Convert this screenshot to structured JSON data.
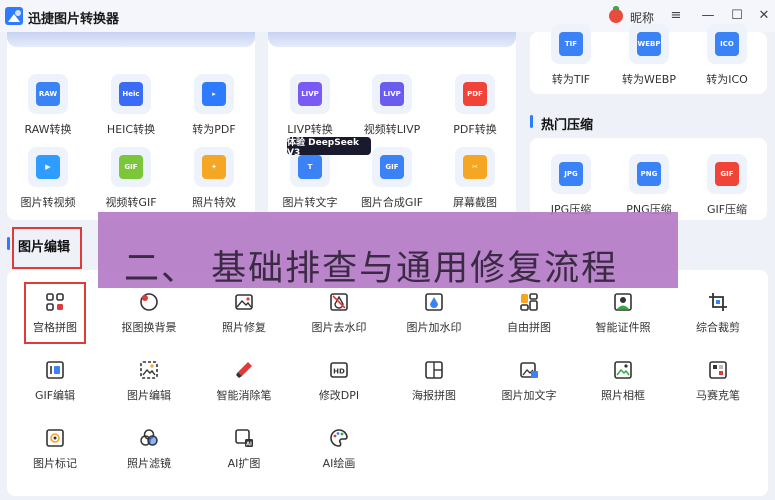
{
  "app": {
    "title": "迅捷图片转换器",
    "nickname": "昵称"
  },
  "window_controls": {
    "menu": "≡",
    "minimize": "—",
    "maximize": "☐",
    "close": "✕"
  },
  "convert_tools_left": [
    {
      "label": "RAW转换",
      "badge": "RAW",
      "color": "#3b82f6"
    },
    {
      "label": "HEIC转换",
      "badge": "Heic",
      "color": "#3b6cf6"
    },
    {
      "label": "转为PDF",
      "badge": "",
      "color": "#2f7bff"
    },
    {
      "label": "图片转视频",
      "badge": "",
      "color": "#2f9dff"
    },
    {
      "label": "视频转GIF",
      "badge": "GIF",
      "color": "#7cc63a"
    },
    {
      "label": "照片特效",
      "badge": "",
      "color": "#f5a623"
    }
  ],
  "convert_tools_mid": [
    {
      "label": "LIVP转换",
      "badge": "LIVP",
      "color": "#7a5af5"
    },
    {
      "label": "视频转LIVP",
      "badge": "LIVP",
      "color": "#6b5cf0"
    },
    {
      "label": "PDF转换",
      "badge": "PDF",
      "color": "#f04438"
    },
    {
      "label": "图片转文字",
      "badge": "",
      "color": "#3b82f6"
    },
    {
      "label": "图片合成GIF",
      "badge": "GIF",
      "color": "#3b82f6"
    },
    {
      "label": "屏幕截图",
      "badge": "",
      "color": "#f5a623"
    }
  ],
  "promo_badge": "体验 DeepSeek V3",
  "convert_tools_right": [
    {
      "label": "转为TIF",
      "badge": "TIF",
      "color": "#3b82f6"
    },
    {
      "label": "转为WEBP",
      "badge": "WEBP",
      "color": "#3b82f6"
    },
    {
      "label": "转为ICO",
      "badge": "ICO",
      "color": "#3b82f6"
    }
  ],
  "compress": {
    "title": "热门压缩",
    "items": [
      {
        "label": "JPG压缩",
        "badge": "JPG",
        "color": "#3b82f6"
      },
      {
        "label": "PNG压缩",
        "badge": "PNG",
        "color": "#3b82f6"
      },
      {
        "label": "GIF压缩",
        "badge": "GIF",
        "color": "#f04438"
      }
    ]
  },
  "edit": {
    "title": "图片编辑",
    "rows": [
      [
        "宫格拼图",
        "抠图换背景",
        "照片修复",
        "图片去水印",
        "图片加水印",
        "自由拼图",
        "智能证件照",
        "综合裁剪"
      ],
      [
        "GIF编辑",
        "图片编辑",
        "智能消除笔",
        "修改DPI",
        "海报拼图",
        "图片加文字",
        "照片相框",
        "马赛克笔"
      ],
      [
        "图片标记",
        "照片滤镜",
        "AI扩图",
        "AI绘画"
      ]
    ]
  },
  "overlay_text": "二、 基础排查与通用修复流程"
}
